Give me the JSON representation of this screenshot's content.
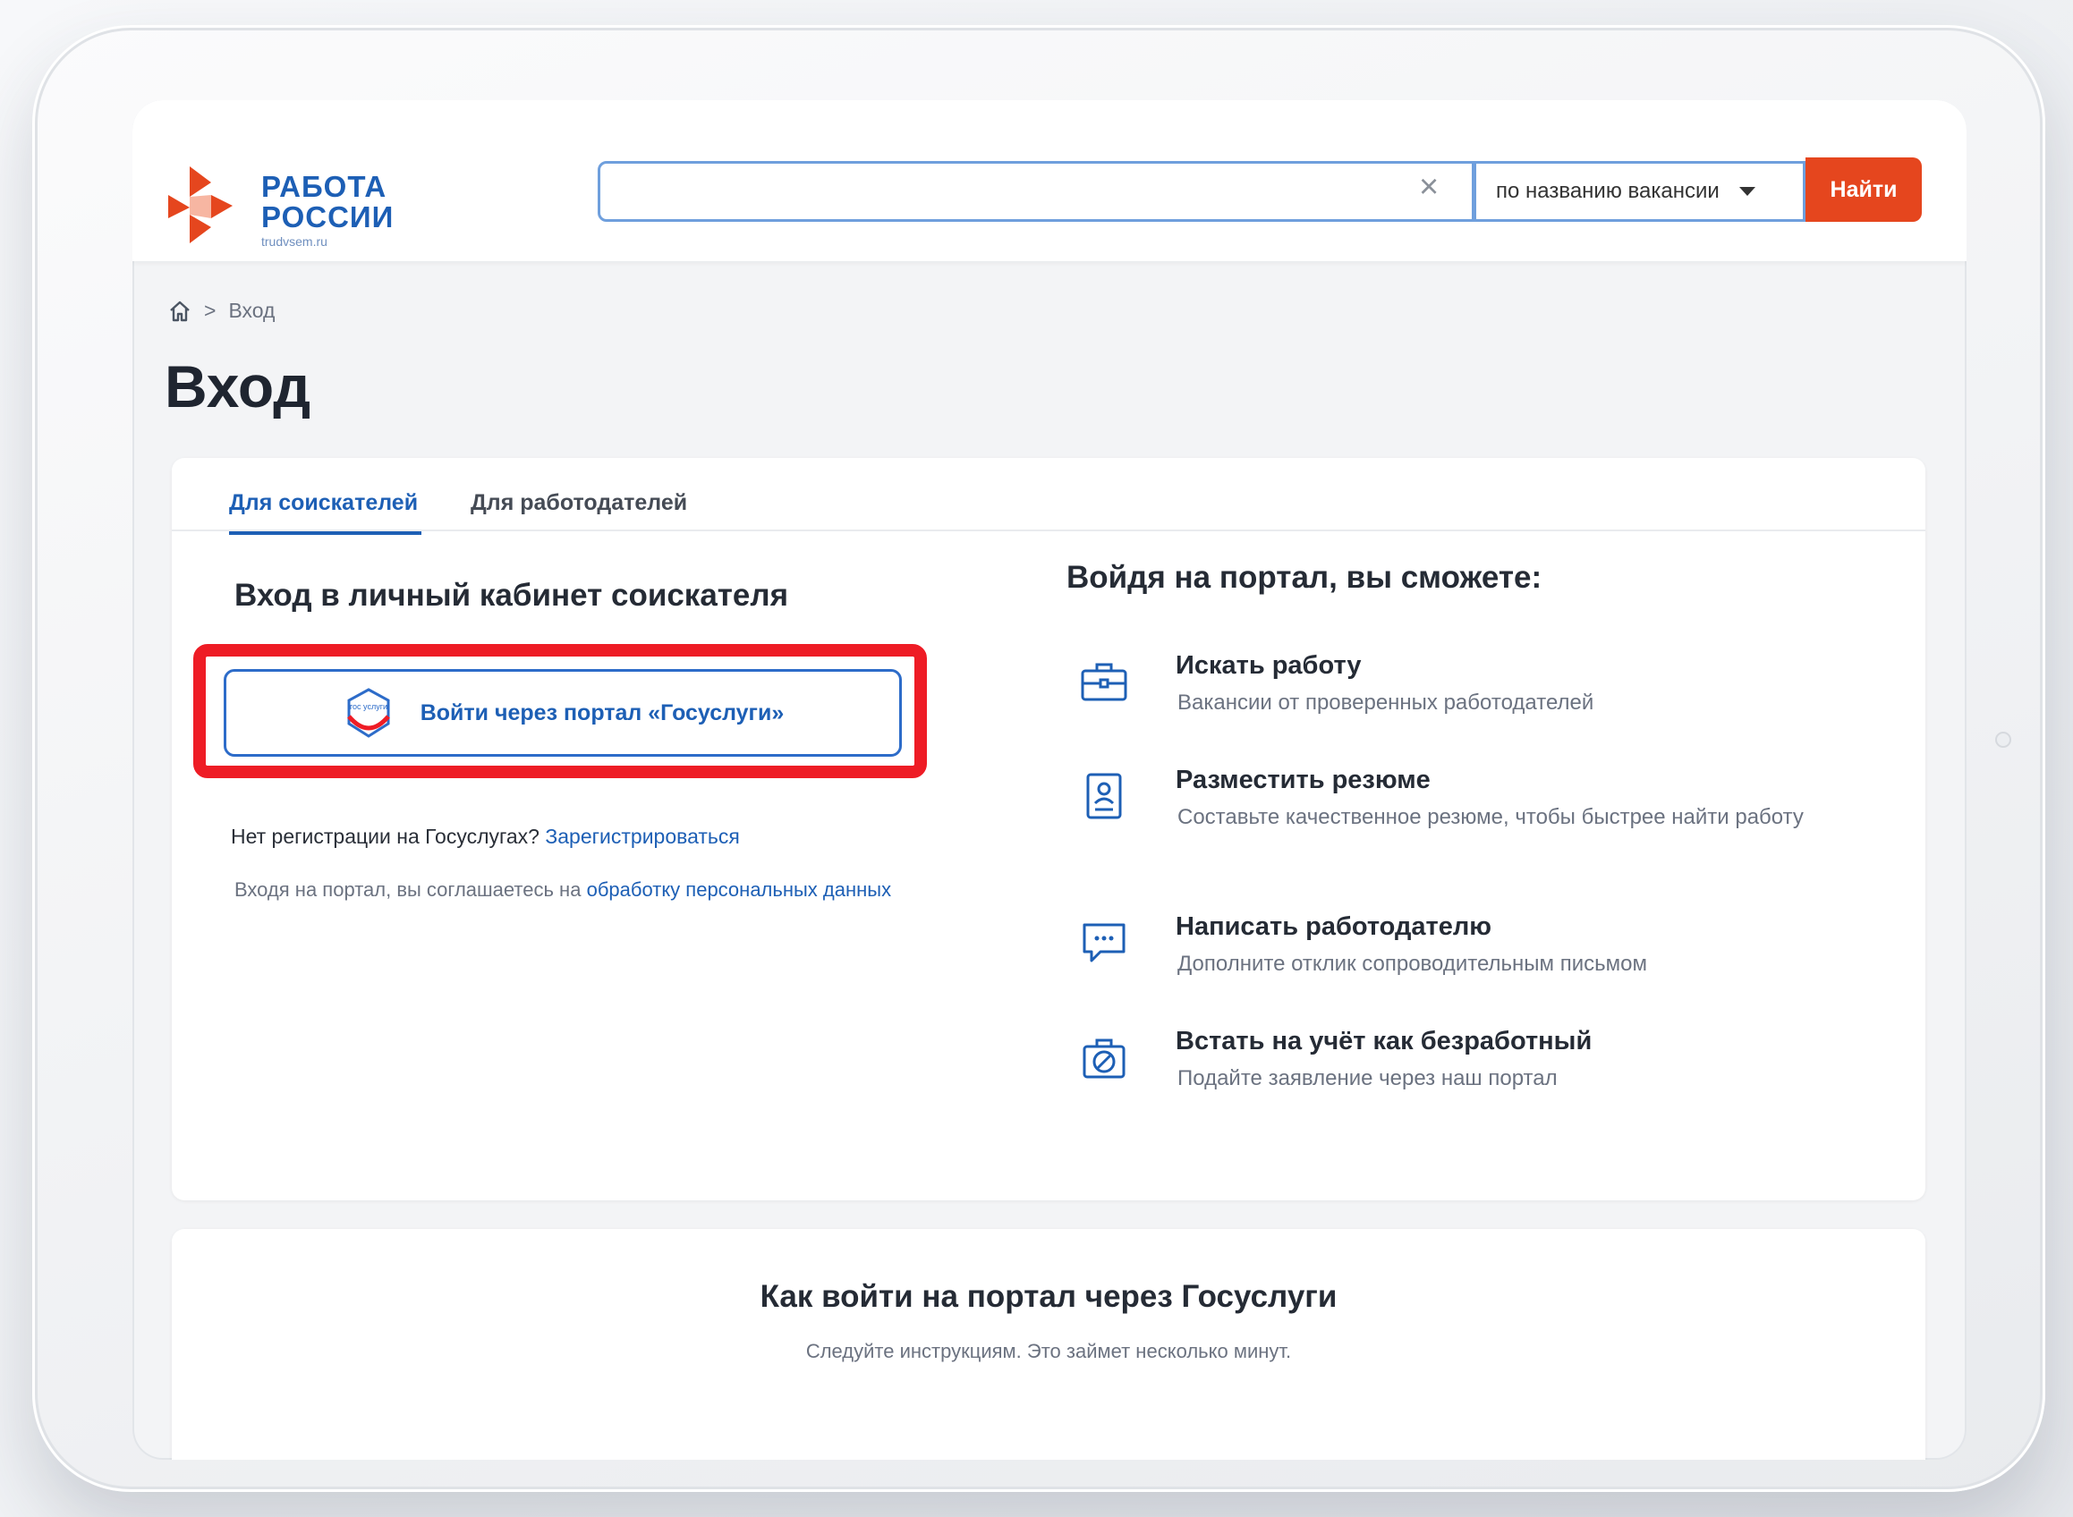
{
  "colors": {
    "brand_blue": "#1d5fb5",
    "search_button": "#e5461e",
    "highlight_frame": "#ee1c25"
  },
  "logo": {
    "line1": "РАБОТА",
    "line2": "РОССИИ",
    "sub": "trudvsem.ru"
  },
  "search": {
    "value": "",
    "placeholder": "",
    "clear_icon": "close-icon",
    "mode_label": "по названию вакансии",
    "button_label": "Найти"
  },
  "breadcrumb": {
    "home_icon": "home-icon",
    "separator": ">",
    "current": "Вход"
  },
  "page": {
    "title": "Вход"
  },
  "tabs": [
    {
      "label": "Для соискателей",
      "active": true
    },
    {
      "label": "Для работодателей",
      "active": false
    }
  ],
  "login": {
    "title": "Вход в личный кабинет соискателя",
    "gosuslugi_button": "Войти через портал «Госуслуги»",
    "gosuslugi_icon_text": "гос услуги",
    "no_registration": "Нет регистрации на Госуслугах?",
    "register_link": "Зарегистрироваться",
    "consent_text": "Входя на портал, вы соглашаетесь на",
    "consent_link": "обработку персональных данных"
  },
  "benefits": {
    "title": "Войдя на портал, вы сможете:",
    "items": [
      {
        "icon": "briefcase-icon",
        "title": "Искать работу",
        "desc": "Вакансии от проверенных работодателей"
      },
      {
        "icon": "resume-icon",
        "title": "Разместить резюме",
        "desc": "Составьте качественное резюме, чтобы быстрее найти работу"
      },
      {
        "icon": "chat-icon",
        "title": "Написать работодателю",
        "desc": "Дополните отклик сопроводительным письмом"
      },
      {
        "icon": "unemployed-icon",
        "title": "Встать на учёт как безработный",
        "desc": "Подайте заявление через наш портал"
      }
    ]
  },
  "howto": {
    "title": "Как войти на портал через Госуслуги",
    "subtitle": "Следуйте инструкциям. Это займет несколько минут."
  }
}
